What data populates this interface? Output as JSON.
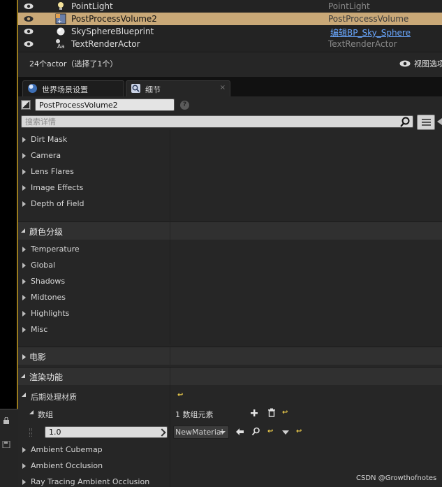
{
  "outliner": {
    "rows": [
      {
        "name": "PointLight",
        "type": "PointLight",
        "icon": "lightbulb-icon",
        "selected": false,
        "link": false
      },
      {
        "name": "PostProcessVolume2",
        "type": "PostProcessVolume",
        "icon": "postprocess-volume-icon",
        "selected": true,
        "link": false
      },
      {
        "name": "SkySphereBlueprint",
        "type": "编辑BP_Sky_Sphere",
        "icon": "sphere-icon",
        "selected": false,
        "link": true
      },
      {
        "name": "TextRenderActor",
        "type": "TextRenderActor",
        "icon": "text-render-icon",
        "selected": false,
        "link": false
      }
    ],
    "status_count": "24个actor（选择了1个）",
    "view_options": "视图选项"
  },
  "tabs": [
    {
      "label": "世界场景设置",
      "icon": "world-globe-icon",
      "active": false
    },
    {
      "label": "细节",
      "icon": "details-magnifier-icon",
      "active": true
    }
  ],
  "details": {
    "object_name": "PostProcessVolume2",
    "search_placeholder": "搜索详情",
    "group_lens": [
      "Dirt Mask",
      "Camera",
      "Lens Flares",
      "Image Effects",
      "Depth of Field"
    ],
    "cat_color_grading": "颜色分级",
    "group_color": [
      "Temperature",
      "Global",
      "Shadows",
      "Midtones",
      "Highlights",
      "Misc"
    ],
    "cat_film": "电影",
    "cat_rendering": "渲染功能",
    "post_process_materials": "后期处理材质",
    "array_label": "数组",
    "array_count": "1 数组元素",
    "array_item_value": "1.0",
    "material_dropdown": "NewMaterial",
    "group_render": [
      "Ambient Cubemap",
      "Ambient Occlusion",
      "Ray Tracing Ambient Occlusion"
    ]
  },
  "watermark": "CSDN @Growthofnotes",
  "colors": {
    "selected_row": "#c9a877",
    "link": "#6aa8ff",
    "reset_arrow": "#e8c84a",
    "panel_bg": "#262626"
  }
}
